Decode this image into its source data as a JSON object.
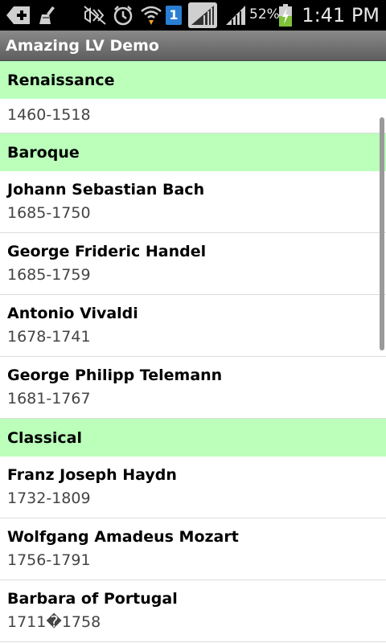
{
  "status_bar": {
    "battery_percent": "52%",
    "time": "1:41 PM",
    "notification_badge": "1",
    "icons": [
      "add-icon",
      "broom-icon",
      "mute-icon",
      "alarm-icon",
      "wifi-icon",
      "sim-badge-icon",
      "signal-icon",
      "signal-icon",
      "battery-charging-icon"
    ]
  },
  "app": {
    "title": "Amazing LV Demo"
  },
  "list": {
    "sections": [
      {
        "header": "Renaissance",
        "items": [
          {
            "name": "",
            "years": "1460-1518"
          }
        ]
      },
      {
        "header": "Baroque",
        "items": [
          {
            "name": "Johann Sebastian Bach",
            "years": "1685-1750"
          },
          {
            "name": "George Frideric Handel",
            "years": "1685-1759"
          },
          {
            "name": "Antonio Vivaldi",
            "years": "1678-1741"
          },
          {
            "name": "George Philipp Telemann",
            "years": "1681-1767"
          }
        ]
      },
      {
        "header": "Classical",
        "items": [
          {
            "name": "Franz Joseph Haydn",
            "years": "1732-1809"
          },
          {
            "name": "Wolfgang Amadeus Mozart",
            "years": "1756-1791"
          },
          {
            "name": "Barbara of Portugal",
            "years": "1711�1758"
          }
        ]
      }
    ]
  },
  "colors": {
    "section_bg": "#bbffbb",
    "status_bar_bg": "#000000",
    "title_bar_bg": "#6e6e6e"
  }
}
